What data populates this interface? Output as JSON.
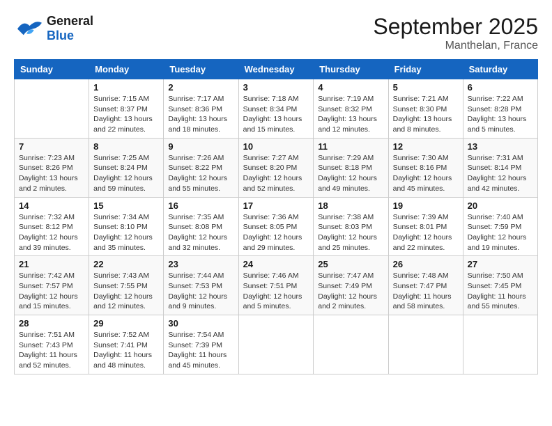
{
  "logo": {
    "line1": "General",
    "line2": "Blue"
  },
  "title": "September 2025",
  "location": "Manthelan, France",
  "weekdays": [
    "Sunday",
    "Monday",
    "Tuesday",
    "Wednesday",
    "Thursday",
    "Friday",
    "Saturday"
  ],
  "weeks": [
    [
      {
        "day": "",
        "sunrise": "",
        "sunset": "",
        "daylight": ""
      },
      {
        "day": "1",
        "sunrise": "Sunrise: 7:15 AM",
        "sunset": "Sunset: 8:37 PM",
        "daylight": "Daylight: 13 hours and 22 minutes."
      },
      {
        "day": "2",
        "sunrise": "Sunrise: 7:17 AM",
        "sunset": "Sunset: 8:36 PM",
        "daylight": "Daylight: 13 hours and 18 minutes."
      },
      {
        "day": "3",
        "sunrise": "Sunrise: 7:18 AM",
        "sunset": "Sunset: 8:34 PM",
        "daylight": "Daylight: 13 hours and 15 minutes."
      },
      {
        "day": "4",
        "sunrise": "Sunrise: 7:19 AM",
        "sunset": "Sunset: 8:32 PM",
        "daylight": "Daylight: 13 hours and 12 minutes."
      },
      {
        "day": "5",
        "sunrise": "Sunrise: 7:21 AM",
        "sunset": "Sunset: 8:30 PM",
        "daylight": "Daylight: 13 hours and 8 minutes."
      },
      {
        "day": "6",
        "sunrise": "Sunrise: 7:22 AM",
        "sunset": "Sunset: 8:28 PM",
        "daylight": "Daylight: 13 hours and 5 minutes."
      }
    ],
    [
      {
        "day": "7",
        "sunrise": "Sunrise: 7:23 AM",
        "sunset": "Sunset: 8:26 PM",
        "daylight": "Daylight: 13 hours and 2 minutes."
      },
      {
        "day": "8",
        "sunrise": "Sunrise: 7:25 AM",
        "sunset": "Sunset: 8:24 PM",
        "daylight": "Daylight: 12 hours and 59 minutes."
      },
      {
        "day": "9",
        "sunrise": "Sunrise: 7:26 AM",
        "sunset": "Sunset: 8:22 PM",
        "daylight": "Daylight: 12 hours and 55 minutes."
      },
      {
        "day": "10",
        "sunrise": "Sunrise: 7:27 AM",
        "sunset": "Sunset: 8:20 PM",
        "daylight": "Daylight: 12 hours and 52 minutes."
      },
      {
        "day": "11",
        "sunrise": "Sunrise: 7:29 AM",
        "sunset": "Sunset: 8:18 PM",
        "daylight": "Daylight: 12 hours and 49 minutes."
      },
      {
        "day": "12",
        "sunrise": "Sunrise: 7:30 AM",
        "sunset": "Sunset: 8:16 PM",
        "daylight": "Daylight: 12 hours and 45 minutes."
      },
      {
        "day": "13",
        "sunrise": "Sunrise: 7:31 AM",
        "sunset": "Sunset: 8:14 PM",
        "daylight": "Daylight: 12 hours and 42 minutes."
      }
    ],
    [
      {
        "day": "14",
        "sunrise": "Sunrise: 7:32 AM",
        "sunset": "Sunset: 8:12 PM",
        "daylight": "Daylight: 12 hours and 39 minutes."
      },
      {
        "day": "15",
        "sunrise": "Sunrise: 7:34 AM",
        "sunset": "Sunset: 8:10 PM",
        "daylight": "Daylight: 12 hours and 35 minutes."
      },
      {
        "day": "16",
        "sunrise": "Sunrise: 7:35 AM",
        "sunset": "Sunset: 8:08 PM",
        "daylight": "Daylight: 12 hours and 32 minutes."
      },
      {
        "day": "17",
        "sunrise": "Sunrise: 7:36 AM",
        "sunset": "Sunset: 8:05 PM",
        "daylight": "Daylight: 12 hours and 29 minutes."
      },
      {
        "day": "18",
        "sunrise": "Sunrise: 7:38 AM",
        "sunset": "Sunset: 8:03 PM",
        "daylight": "Daylight: 12 hours and 25 minutes."
      },
      {
        "day": "19",
        "sunrise": "Sunrise: 7:39 AM",
        "sunset": "Sunset: 8:01 PM",
        "daylight": "Daylight: 12 hours and 22 minutes."
      },
      {
        "day": "20",
        "sunrise": "Sunrise: 7:40 AM",
        "sunset": "Sunset: 7:59 PM",
        "daylight": "Daylight: 12 hours and 19 minutes."
      }
    ],
    [
      {
        "day": "21",
        "sunrise": "Sunrise: 7:42 AM",
        "sunset": "Sunset: 7:57 PM",
        "daylight": "Daylight: 12 hours and 15 minutes."
      },
      {
        "day": "22",
        "sunrise": "Sunrise: 7:43 AM",
        "sunset": "Sunset: 7:55 PM",
        "daylight": "Daylight: 12 hours and 12 minutes."
      },
      {
        "day": "23",
        "sunrise": "Sunrise: 7:44 AM",
        "sunset": "Sunset: 7:53 PM",
        "daylight": "Daylight: 12 hours and 9 minutes."
      },
      {
        "day": "24",
        "sunrise": "Sunrise: 7:46 AM",
        "sunset": "Sunset: 7:51 PM",
        "daylight": "Daylight: 12 hours and 5 minutes."
      },
      {
        "day": "25",
        "sunrise": "Sunrise: 7:47 AM",
        "sunset": "Sunset: 7:49 PM",
        "daylight": "Daylight: 12 hours and 2 minutes."
      },
      {
        "day": "26",
        "sunrise": "Sunrise: 7:48 AM",
        "sunset": "Sunset: 7:47 PM",
        "daylight": "Daylight: 11 hours and 58 minutes."
      },
      {
        "day": "27",
        "sunrise": "Sunrise: 7:50 AM",
        "sunset": "Sunset: 7:45 PM",
        "daylight": "Daylight: 11 hours and 55 minutes."
      }
    ],
    [
      {
        "day": "28",
        "sunrise": "Sunrise: 7:51 AM",
        "sunset": "Sunset: 7:43 PM",
        "daylight": "Daylight: 11 hours and 52 minutes."
      },
      {
        "day": "29",
        "sunrise": "Sunrise: 7:52 AM",
        "sunset": "Sunset: 7:41 PM",
        "daylight": "Daylight: 11 hours and 48 minutes."
      },
      {
        "day": "30",
        "sunrise": "Sunrise: 7:54 AM",
        "sunset": "Sunset: 7:39 PM",
        "daylight": "Daylight: 11 hours and 45 minutes."
      },
      {
        "day": "",
        "sunrise": "",
        "sunset": "",
        "daylight": ""
      },
      {
        "day": "",
        "sunrise": "",
        "sunset": "",
        "daylight": ""
      },
      {
        "day": "",
        "sunrise": "",
        "sunset": "",
        "daylight": ""
      },
      {
        "day": "",
        "sunrise": "",
        "sunset": "",
        "daylight": ""
      }
    ]
  ]
}
